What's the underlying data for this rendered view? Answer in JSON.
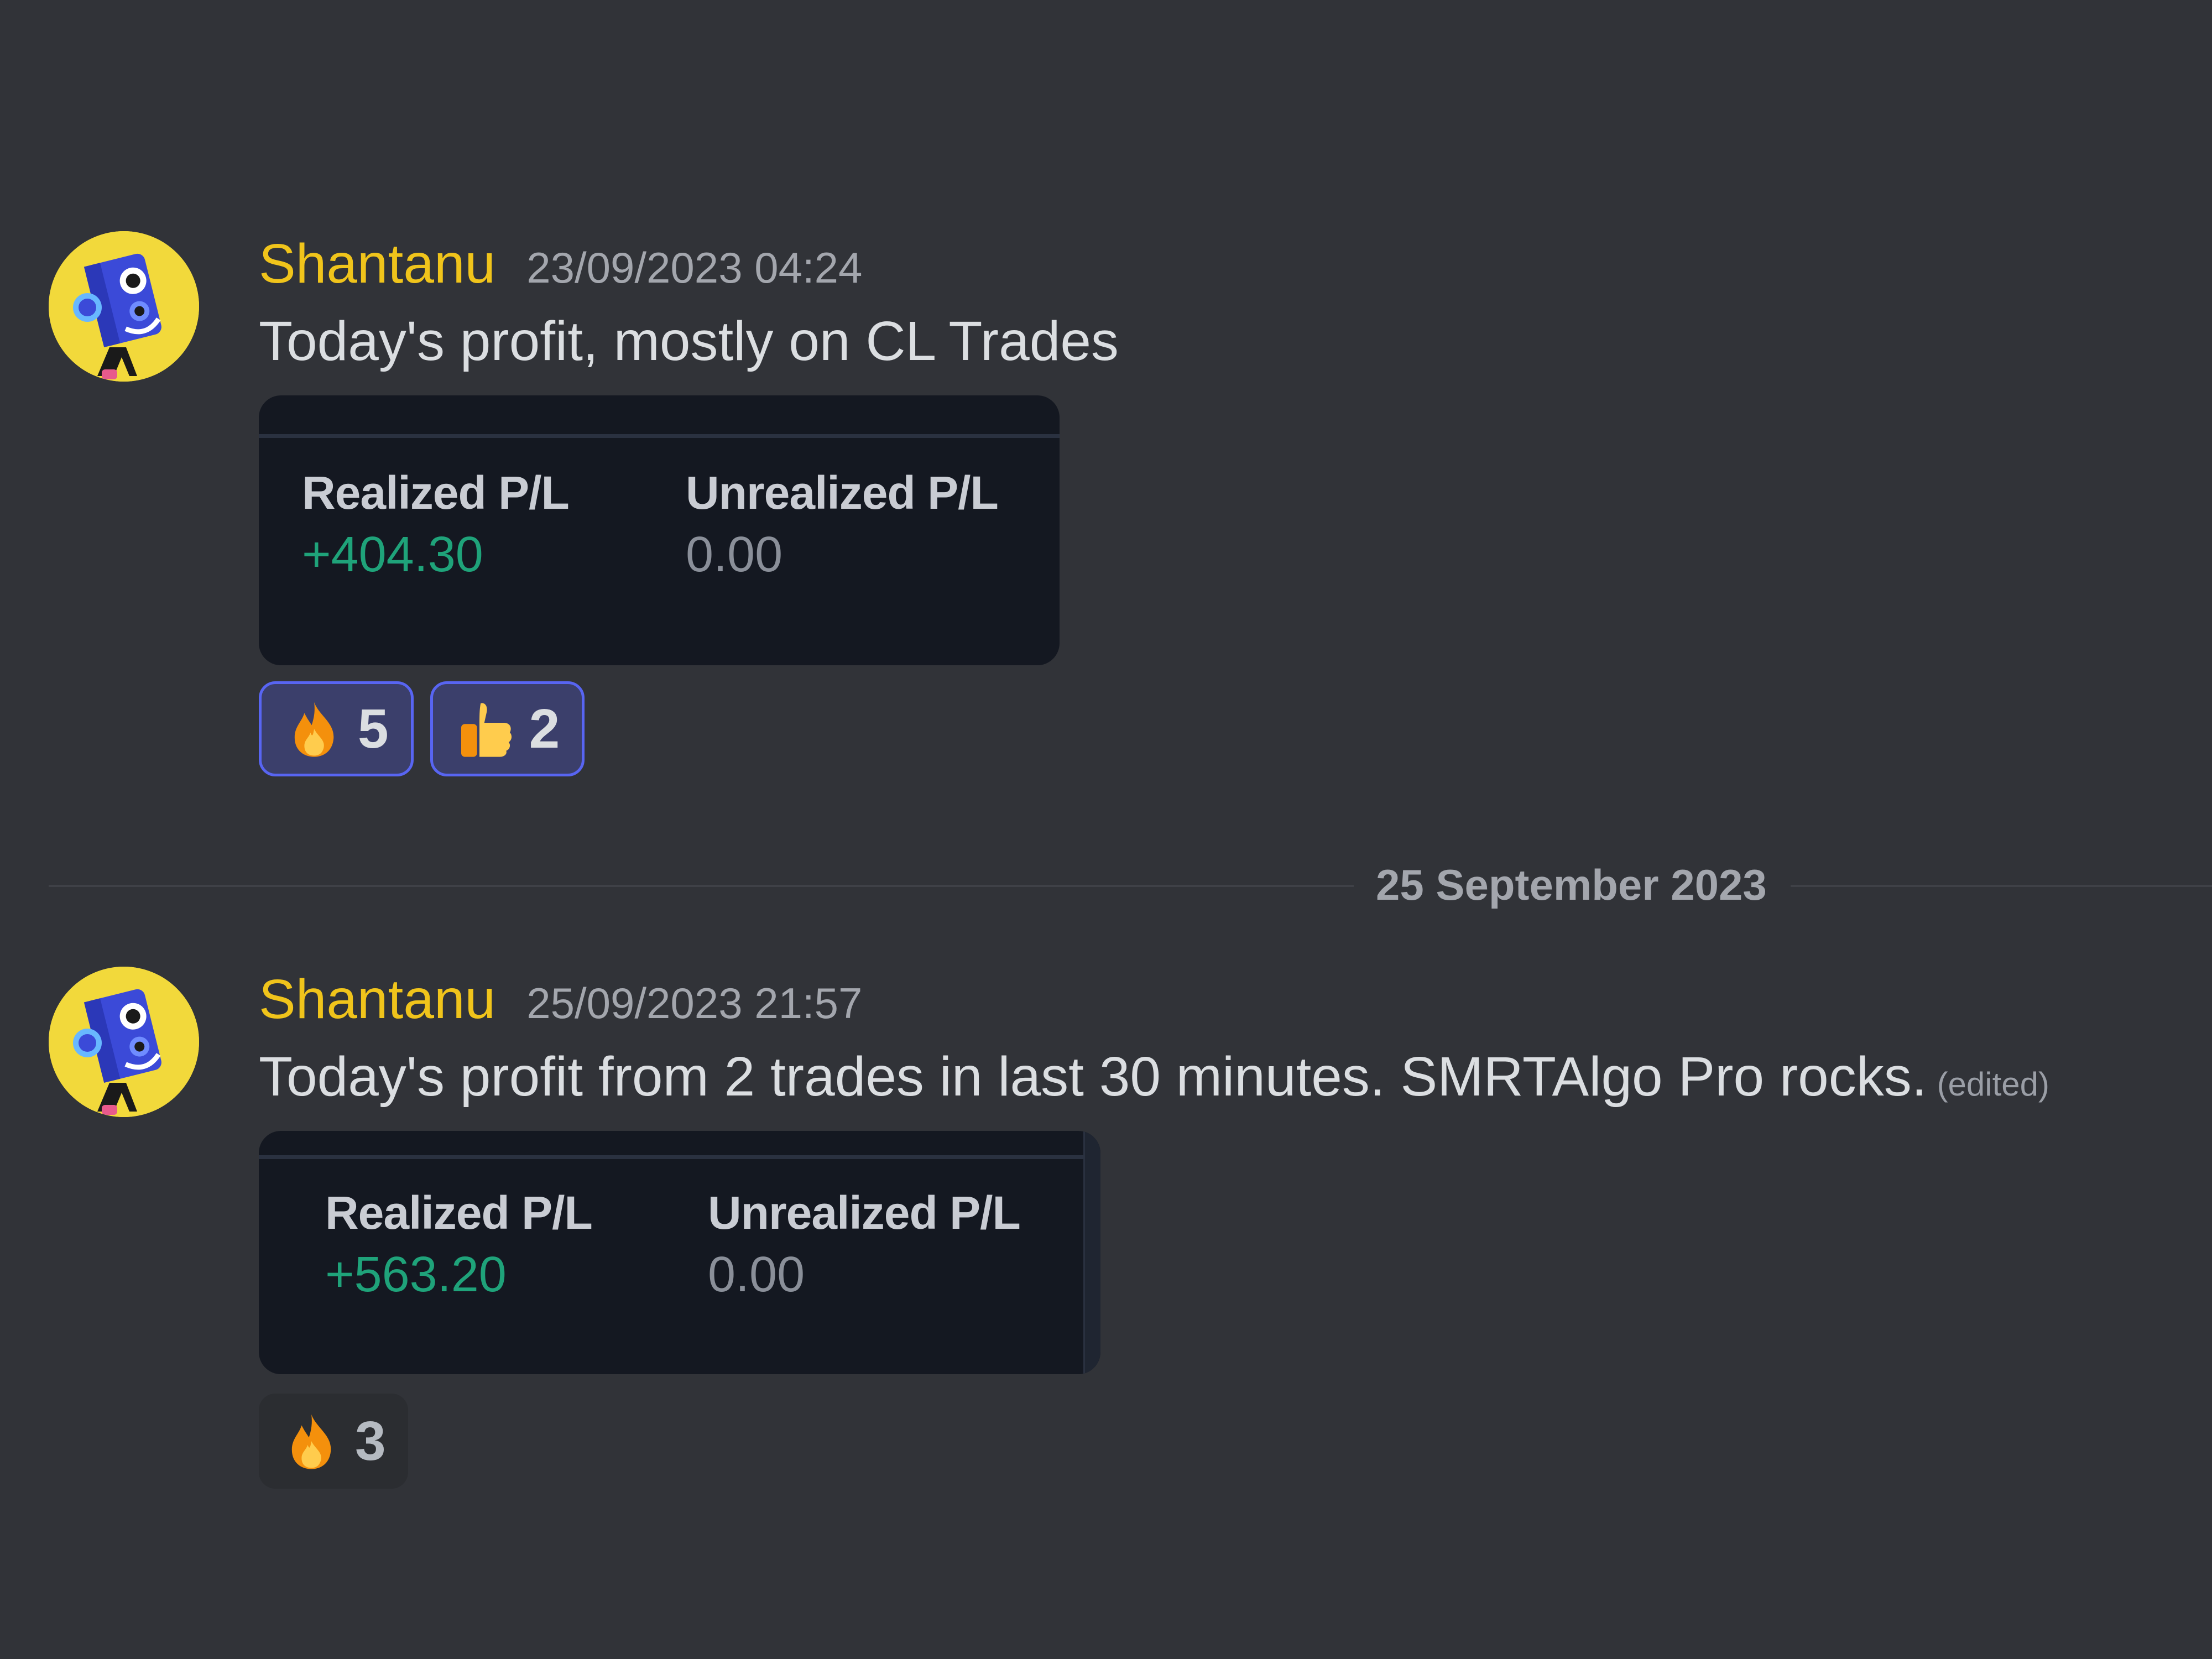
{
  "colors": {
    "background": "#313338",
    "username": "#f0c41b",
    "profit": "#1fa37a",
    "reaction_active_border": "#5865f2"
  },
  "messages": [
    {
      "author": "Shantanu",
      "timestamp": "23/09/2023 04:24",
      "text": "Today's profit, mostly on CL Trades",
      "edited": "",
      "embed": {
        "realized_label": "Realized P/L",
        "realized_value": "+404.30",
        "unrealized_label": "Unrealized P/L",
        "unrealized_value": "0.00"
      },
      "reactions": [
        {
          "emoji": "fire",
          "count": "5",
          "active": true
        },
        {
          "emoji": "thumbs-up",
          "count": "2",
          "active": true
        }
      ]
    },
    {
      "author": "Shantanu",
      "timestamp": "25/09/2023 21:57",
      "text": "Today's profit from 2 trades in last 30 minutes.  SMRTAlgo Pro rocks.",
      "edited": "(edited)",
      "embed": {
        "realized_label": "Realized P/L",
        "realized_value": "+563.20",
        "unrealized_label": "Unrealized P/L",
        "unrealized_value": "0.00"
      },
      "reactions": [
        {
          "emoji": "fire",
          "count": "3",
          "active": false
        }
      ]
    }
  ],
  "date_divider": {
    "label": "25 September 2023"
  }
}
